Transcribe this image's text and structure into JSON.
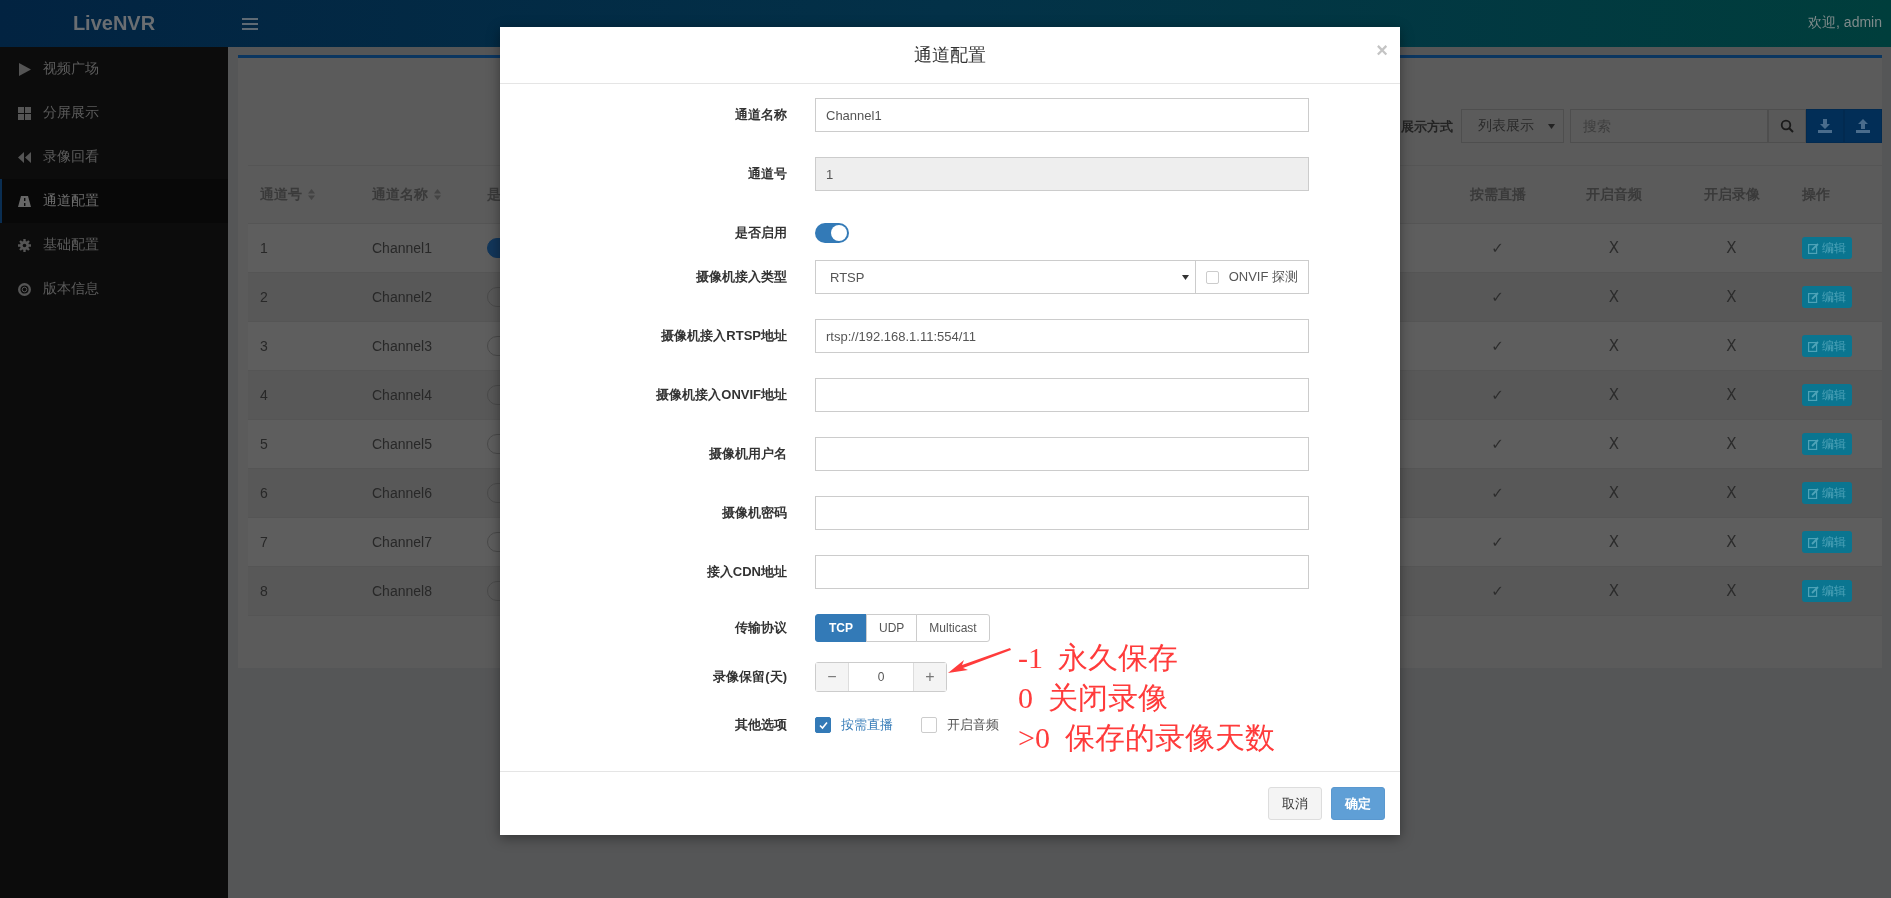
{
  "header": {
    "logo": "LiveNVR",
    "welcome": "欢迎, admin"
  },
  "sidebar": {
    "items": [
      {
        "label": "视频广场",
        "selected": false
      },
      {
        "label": "分屏展示",
        "selected": false
      },
      {
        "label": "录像回看",
        "selected": false
      },
      {
        "label": "通道配置",
        "selected": true
      },
      {
        "label": "基础配置",
        "selected": false
      },
      {
        "label": "版本信息",
        "selected": false
      }
    ]
  },
  "toolbar": {
    "display_label": "展示方式",
    "display_select": "列表展示",
    "search": {
      "placeholder": "搜索"
    }
  },
  "table": {
    "columns": [
      {
        "label": "通道号",
        "sortable": true
      },
      {
        "label": "通道名称",
        "sortable": true
      },
      {
        "label": "是"
      },
      {
        "label": "按需直播",
        "sortable": false
      },
      {
        "label": "开启音频",
        "sortable": false
      },
      {
        "label": "开启录像",
        "sortable": false
      },
      {
        "label": "操作",
        "sortable": false
      }
    ],
    "rows": [
      {
        "id": "1",
        "name": "Channel1",
        "enabled": true,
        "on_demand": "✓",
        "audio": "X",
        "record": "X",
        "action": "编辑"
      },
      {
        "id": "2",
        "name": "Channel2",
        "enabled": false,
        "on_demand": "✓",
        "audio": "X",
        "record": "X",
        "action": "编辑"
      },
      {
        "id": "3",
        "name": "Channel3",
        "enabled": false,
        "on_demand": "✓",
        "audio": "X",
        "record": "X",
        "action": "编辑"
      },
      {
        "id": "4",
        "name": "Channel4",
        "enabled": false,
        "on_demand": "✓",
        "audio": "X",
        "record": "X",
        "action": "编辑"
      },
      {
        "id": "5",
        "name": "Channel5",
        "enabled": false,
        "on_demand": "✓",
        "audio": "X",
        "record": "X",
        "action": "编辑"
      },
      {
        "id": "6",
        "name": "Channel6",
        "enabled": false,
        "on_demand": "✓",
        "audio": "X",
        "record": "X",
        "action": "编辑"
      },
      {
        "id": "7",
        "name": "Channel7",
        "enabled": false,
        "on_demand": "✓",
        "audio": "X",
        "record": "X",
        "action": "编辑"
      },
      {
        "id": "8",
        "name": "Channel8",
        "enabled": false,
        "on_demand": "✓",
        "audio": "X",
        "record": "X",
        "action": "编辑"
      }
    ]
  },
  "modal": {
    "title": "通道配置",
    "close": "×",
    "fields": [
      {
        "kind": "text",
        "label": "通道名称",
        "value": "Channel1",
        "disabled": false
      },
      {
        "kind": "text",
        "label": "通道号",
        "value": "1",
        "disabled": true
      },
      {
        "kind": "toggle",
        "label": "是否启用",
        "on": true
      },
      {
        "kind": "select",
        "label": "摄像机接入类型",
        "value": "RTSP",
        "extra": {
          "label": "ONVIF 探测",
          "checked": false
        }
      },
      {
        "kind": "text",
        "label": "摄像机接入RTSP地址",
        "value": "rtsp://192.168.1.11:554/11",
        "disabled": false
      },
      {
        "kind": "text",
        "label": "摄像机接入ONVIF地址",
        "disabled": false
      },
      {
        "kind": "text",
        "label": "摄像机用户名",
        "disabled": false
      },
      {
        "kind": "text",
        "label": "摄像机密码",
        "disabled": false
      },
      {
        "kind": "text",
        "label": "接入CDN地址",
        "disabled": false
      },
      {
        "kind": "segmented",
        "label": "传输协议",
        "options": [
          {
            "label": "TCP",
            "selected": true
          },
          {
            "label": "UDP",
            "selected": false
          },
          {
            "label": "Multicast",
            "selected": false
          }
        ]
      },
      {
        "kind": "stepper",
        "label": "录像保留(天)",
        "minus": "−",
        "value": "0",
        "plus": "+"
      },
      {
        "kind": "checks",
        "label": "其他选项",
        "options": [
          {
            "label": "按需直播",
            "checked": true
          },
          {
            "label": "开启音频",
            "checked": false
          }
        ]
      }
    ],
    "buttons": [
      {
        "label": "取消",
        "kind": "default"
      },
      {
        "label": "确定",
        "kind": "primary"
      }
    ],
    "annotation": {
      "lines": [
        "-1  永久保存",
        "0  关闭录像",
        ">0  保存的录像天数"
      ]
    }
  }
}
